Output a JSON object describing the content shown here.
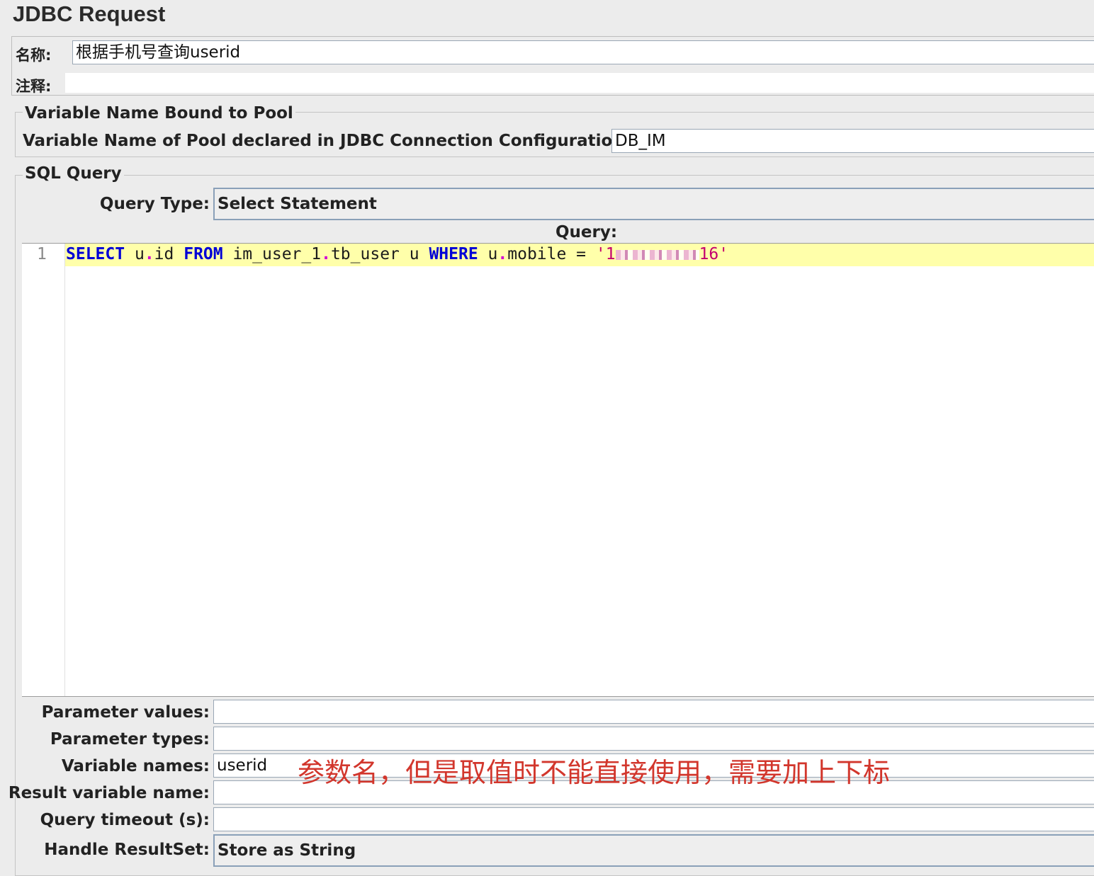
{
  "panel": {
    "title": "JDBC Request"
  },
  "name_section": {
    "name_label": "名称:",
    "name_value": "根据手机号查询userid",
    "comment_label": "注释:",
    "comment_value": ""
  },
  "pool_section": {
    "legend": "Variable Name Bound to Pool",
    "pool_label": "Variable Name of Pool declared in JDBC Connection Configuration:",
    "pool_value": "DB_IM"
  },
  "sql_section": {
    "legend": "SQL Query",
    "query_type_label": "Query Type:",
    "query_type_value": "Select Statement",
    "query_label": "Query:",
    "line_number": "1",
    "query_tokens": {
      "select": "SELECT",
      "u1": "u",
      "dot1": ".",
      "id": "id ",
      "from": "FROM",
      "schema": " im_user_1",
      "dot2": ".",
      "table": "tb_user u ",
      "where": "WHERE",
      "u2": " u",
      "dot3": ".",
      "mobile": "mobile = ",
      "str_start": "'1",
      "str_end": "16'"
    }
  },
  "params": {
    "parameter_values_label": "Parameter values:",
    "parameter_values_value": "",
    "parameter_types_label": "Parameter types:",
    "parameter_types_value": "",
    "variable_names_label": "Variable names:",
    "variable_names_value": "userid",
    "result_variable_label": "Result variable name:",
    "result_variable_value": "",
    "query_timeout_label": "Query timeout (s):",
    "query_timeout_value": "",
    "handle_resultset_label": "Handle ResultSet:",
    "handle_resultset_value": "Store as String"
  },
  "annotation": "参数名，但是取值时不能直接使用，需要加上下标",
  "colors": {
    "keyword": "#0000d6",
    "string": "#c4006e",
    "annotation": "#d2362c",
    "line_highlight": "#ffffaa"
  }
}
